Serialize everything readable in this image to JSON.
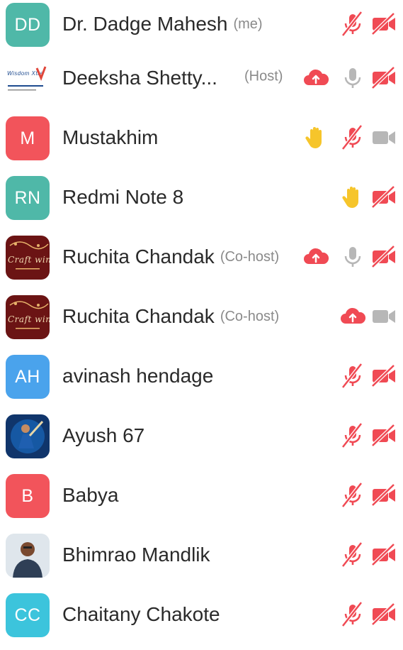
{
  "colors": {
    "teal": "#4fb8a8",
    "red": "#f2545b",
    "blue": "#4aa3ec",
    "cyan": "#3cc4dc",
    "muted_icon": "#b7b7b7",
    "off_icon": "#f04a54",
    "cloud": "#f04a54",
    "hand": "#f6c52b"
  },
  "participants": [
    {
      "initials": "DD",
      "name": "Dr. Dadge Mahesh",
      "tag": "(me)",
      "avatar": "initials",
      "avatar_color": "teal",
      "icons": [
        "mic-off",
        "video-off"
      ]
    },
    {
      "initials": "",
      "name": "Deeksha Shetty...",
      "tag": "(Host)",
      "avatar": "image",
      "avatar_image": "wisdom-xtra-logo",
      "logo_text": "Wisdom Xtra",
      "icons": [
        "cloud",
        "mic-on",
        "video-off"
      ]
    },
    {
      "initials": "M",
      "name": "Mustakhim",
      "tag": "",
      "avatar": "initials",
      "avatar_color": "red",
      "icons": [
        "hand",
        "mic-off",
        "video-on"
      ]
    },
    {
      "initials": "RN",
      "name": "Redmi Note 8",
      "tag": "",
      "avatar": "initials",
      "avatar_color": "teal",
      "icons": [
        "hand",
        "video-off"
      ]
    },
    {
      "initials": "",
      "name": "Ruchita Chandak",
      "tag": "(Co-host)",
      "avatar": "image",
      "avatar_image": "craft-wing-logo",
      "logo_text": "Craft wing",
      "icons": [
        "cloud",
        "mic-on",
        "video-off"
      ]
    },
    {
      "initials": "",
      "name": "Ruchita Chandak",
      "tag": "(Co-host)",
      "avatar": "image",
      "avatar_image": "craft-wing-logo",
      "logo_text": "Craft wing",
      "icons": [
        "cloud",
        "video-on"
      ]
    },
    {
      "initials": "AH",
      "name": "avinash hendage",
      "tag": "",
      "avatar": "initials",
      "avatar_color": "blue",
      "icons": [
        "mic-off",
        "video-off"
      ]
    },
    {
      "initials": "",
      "name": "Ayush 67",
      "tag": "",
      "avatar": "image",
      "avatar_image": "cricketer-photo",
      "icons": [
        "mic-off",
        "video-off"
      ]
    },
    {
      "initials": "B",
      "name": "Babya",
      "tag": "",
      "avatar": "initials",
      "avatar_color": "red",
      "icons": [
        "mic-off",
        "video-off"
      ]
    },
    {
      "initials": "",
      "name": "Bhimrao Mandlik",
      "tag": "",
      "avatar": "image",
      "avatar_image": "person-photo",
      "icons": [
        "mic-off",
        "video-off"
      ]
    },
    {
      "initials": "CC",
      "name": "Chaitany Chakote",
      "tag": "",
      "avatar": "initials",
      "avatar_color": "cyan",
      "icons": [
        "mic-off",
        "video-off"
      ]
    }
  ]
}
